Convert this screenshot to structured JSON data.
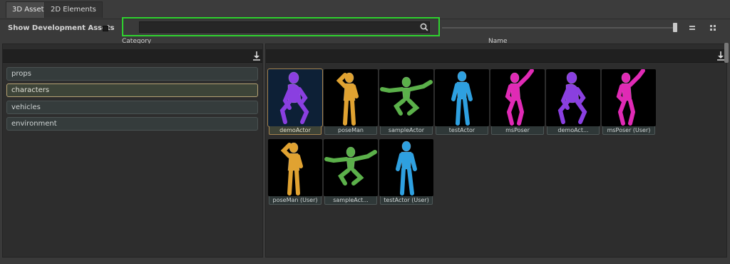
{
  "tabs": [
    {
      "label": "3D Assets",
      "active": true
    },
    {
      "label": "2D Elements",
      "active": false
    }
  ],
  "toolbar": {
    "show_dev_label": "Show Development Assets",
    "search_value": "",
    "search_placeholder": "",
    "highlight_color": "#2fd32f"
  },
  "columns": {
    "category": "Category",
    "name": "Name"
  },
  "categories": [
    {
      "label": "props",
      "selected": false
    },
    {
      "label": "characters",
      "selected": true
    },
    {
      "label": "vehicles",
      "selected": false
    },
    {
      "label": "environment",
      "selected": false
    }
  ],
  "assets": [
    {
      "label": "demoActor",
      "color": "#8a3fe0",
      "pose": "crouch",
      "selected": true
    },
    {
      "label": "poseMan",
      "color": "#e0a231",
      "pose": "salute",
      "selected": false
    },
    {
      "label": "sampleActor",
      "color": "#5bb04a",
      "pose": "leap",
      "selected": false
    },
    {
      "label": "testActor",
      "color": "#2ea0e0",
      "pose": "stand",
      "selected": false
    },
    {
      "label": "msPoser",
      "color": "#e02ab5",
      "pose": "dance",
      "selected": false
    },
    {
      "label": "demoAct...",
      "color": "#8a3fe0",
      "pose": "crouch",
      "selected": false
    },
    {
      "label": "msPoser (User)",
      "color": "#e02ab5",
      "pose": "dance",
      "selected": false
    },
    {
      "label": "poseMan (User)",
      "color": "#e0a231",
      "pose": "salute",
      "selected": false
    },
    {
      "label": "sampleAct...",
      "color": "#5bb04a",
      "pose": "leap",
      "selected": false
    },
    {
      "label": "testActor (User)",
      "color": "#2ea0e0",
      "pose": "stand",
      "selected": false
    }
  ]
}
